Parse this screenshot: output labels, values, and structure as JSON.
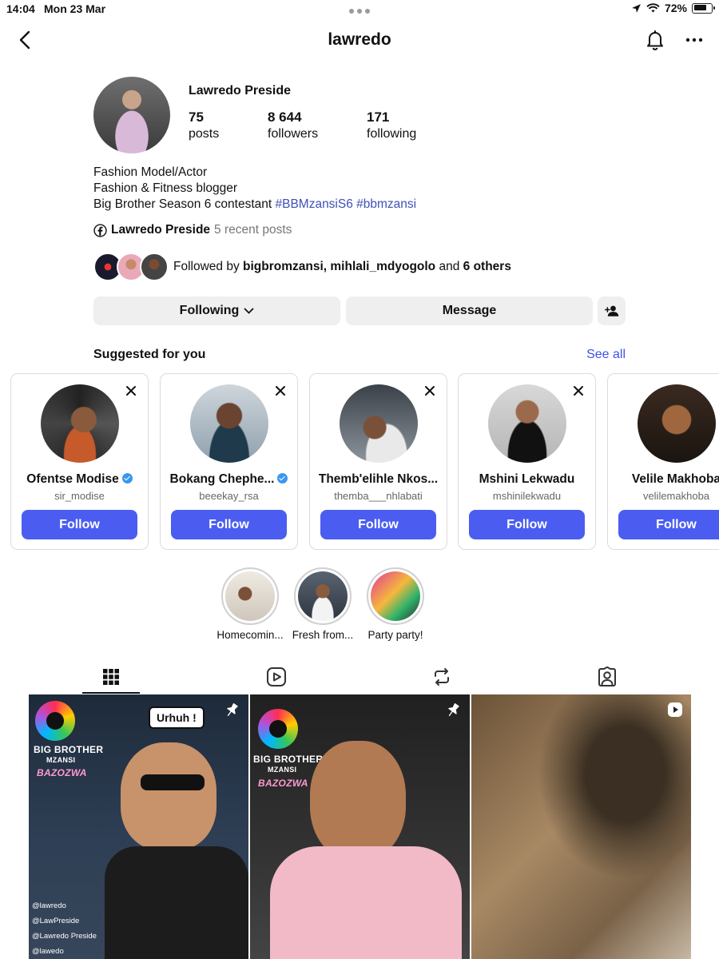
{
  "status_bar": {
    "time": "14:04",
    "date": "Mon 23 Mar",
    "battery": "72%"
  },
  "nav": {
    "title": "lawredo"
  },
  "profile": {
    "name": "Lawredo Preside",
    "stats": [
      {
        "num": "75",
        "label": "posts"
      },
      {
        "num": "8 644",
        "label": "followers"
      },
      {
        "num": "171",
        "label": "following"
      }
    ],
    "bio_line1": "Fashion Model/Actor",
    "bio_line2": "Fashion & Fitness blogger",
    "bio_line3_text": "Big Brother Season 6 contestant ",
    "bio_tag1": "#BBMzansiS6",
    "bio_tag2": "#bbmzansi",
    "fb_name": "Lawredo Preside",
    "fb_sub": "5 recent posts",
    "followed_prefix": "Followed by ",
    "followed_names": "bigbromzansi, mihlali_mdyogolo",
    "followed_and": " and ",
    "followed_others": "6 others"
  },
  "buttons": {
    "following": "Following",
    "message": "Message"
  },
  "suggested": {
    "title": "Suggested for you",
    "see_all": "See all",
    "people": [
      {
        "name": "Ofentse Modise",
        "handle": "sir_modise",
        "verified": true,
        "follow": "Follow"
      },
      {
        "name": "Bokang Chephe...",
        "handle": "beeekay_rsa",
        "verified": true,
        "follow": "Follow"
      },
      {
        "name": "Themb'elihle Nkos...",
        "handle": "themba___nhlabati",
        "verified": false,
        "follow": "Follow"
      },
      {
        "name": "Mshini Lekwadu",
        "handle": "mshinilekwadu",
        "verified": false,
        "follow": "Follow"
      },
      {
        "name": "Velile Makhoba",
        "handle": "velilemakhoba",
        "verified": false,
        "follow": "Follow"
      }
    ]
  },
  "highlights": [
    {
      "label": "Homecomin..."
    },
    {
      "label": "Fresh from..."
    },
    {
      "label": "Party party!"
    }
  ],
  "posts": {
    "p1": {
      "bubble": "Urhuh !",
      "line1": "BIG BROTHER",
      "line2": "MZANSI",
      "line3": "BAZOZWA",
      "tag1": "@lawredo",
      "tag2": "@LawPreside",
      "tag3": "@Lawredo Preside",
      "tag4": "@lawedo"
    },
    "p2": {
      "line1": "BIG BROTHER",
      "line2": "MZANSI",
      "line3": "BAZOZWA"
    }
  },
  "colors": {
    "accent": "#4a5df0",
    "link": "#3f51e5",
    "button_bg": "#efeff0"
  }
}
